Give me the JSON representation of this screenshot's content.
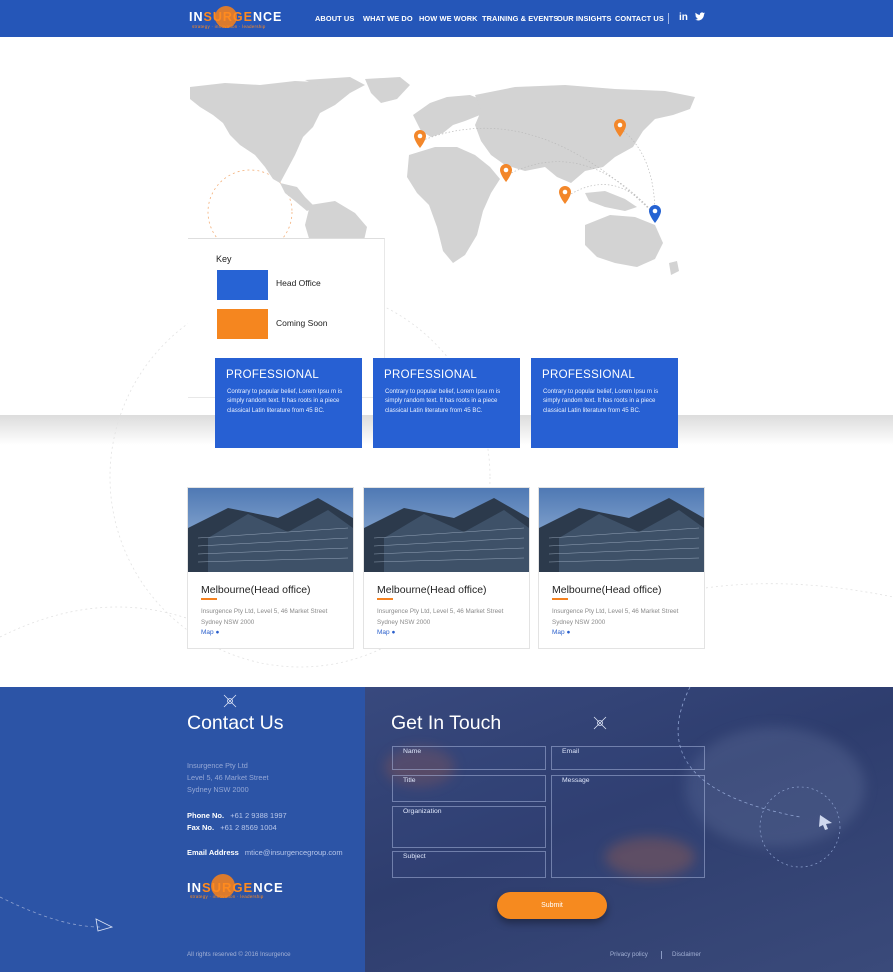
{
  "nav": {
    "logo": {
      "pre": "IN",
      "acc": "SURGE",
      "post": "NCE",
      "tagline": "strategy · innovation · leadership"
    },
    "links": [
      "ABOUT US",
      "WHAT WE DO",
      "HOW WE WORK",
      "TRAINING & EVENTS",
      "OUR INSIGHTS",
      "CONTACT US"
    ],
    "social": [
      "in",
      "🐦"
    ]
  },
  "key": {
    "title": "Key",
    "items": [
      {
        "label": "Head Office",
        "color": "#2763d4"
      },
      {
        "label": "Coming Soon",
        "color": "#f5861f"
      }
    ]
  },
  "pins": {
    "head_office_color": "#2563d3",
    "coming_soon_color": "#f3872a"
  },
  "professional": [
    {
      "title": "PROFESSIONAL",
      "text": "Contrary to popular belief, Lorem Ipsu m is simply random text. It has roots in a piece classical Latin literature from 45 BC."
    },
    {
      "title": "PROFESSIONAL",
      "text": "Contrary to popular belief, Lorem Ipsu m is simply random text. It has roots in a piece classical Latin literature from 45 BC."
    },
    {
      "title": "PROFESSIONAL",
      "text": "Contrary to popular belief, Lorem Ipsu m is simply random text. It has roots in a piece classical Latin literature from 45 BC."
    }
  ],
  "offices": [
    {
      "title": "Melbourne(Head office)",
      "addr1": "Insurgence Pty Ltd, Level 5, 46 Market Street",
      "addr2": "Sydney NSW 2000",
      "map": "Map"
    },
    {
      "title": "Melbourne(Head office)",
      "addr1": "Insurgence Pty Ltd, Level 5, 46 Market Street",
      "addr2": "Sydney NSW 2000",
      "map": "Map"
    },
    {
      "title": "Melbourne(Head office)",
      "addr1": "Insurgence Pty Ltd, Level 5, 46 Market Street",
      "addr2": "Sydney NSW 2000",
      "map": "Map"
    }
  ],
  "contact": {
    "title": "Contact Us",
    "address": [
      "Insurgence Pty Ltd",
      "Level 5, 46 Market Street",
      "Sydney NSW 2000"
    ],
    "phone_label": "Phone No.",
    "phone": "+61 2 9388 1997",
    "fax_label": "Fax No.",
    "fax": "+61 2 8569 1004",
    "email_label": "Email Address",
    "email": "mtice@insurgencegroup.com"
  },
  "form": {
    "title": "Get In Touch",
    "fields": {
      "name": "Name",
      "email": "Email",
      "title": "Title",
      "message": "Message",
      "organization": "Organization",
      "subject": "Subject"
    },
    "submit": "Submit"
  },
  "footer": {
    "copyright": "All rights reserved © 2016 Insurgence",
    "privacy": "Privacy policy",
    "disclaimer": "Disclaimer"
  }
}
